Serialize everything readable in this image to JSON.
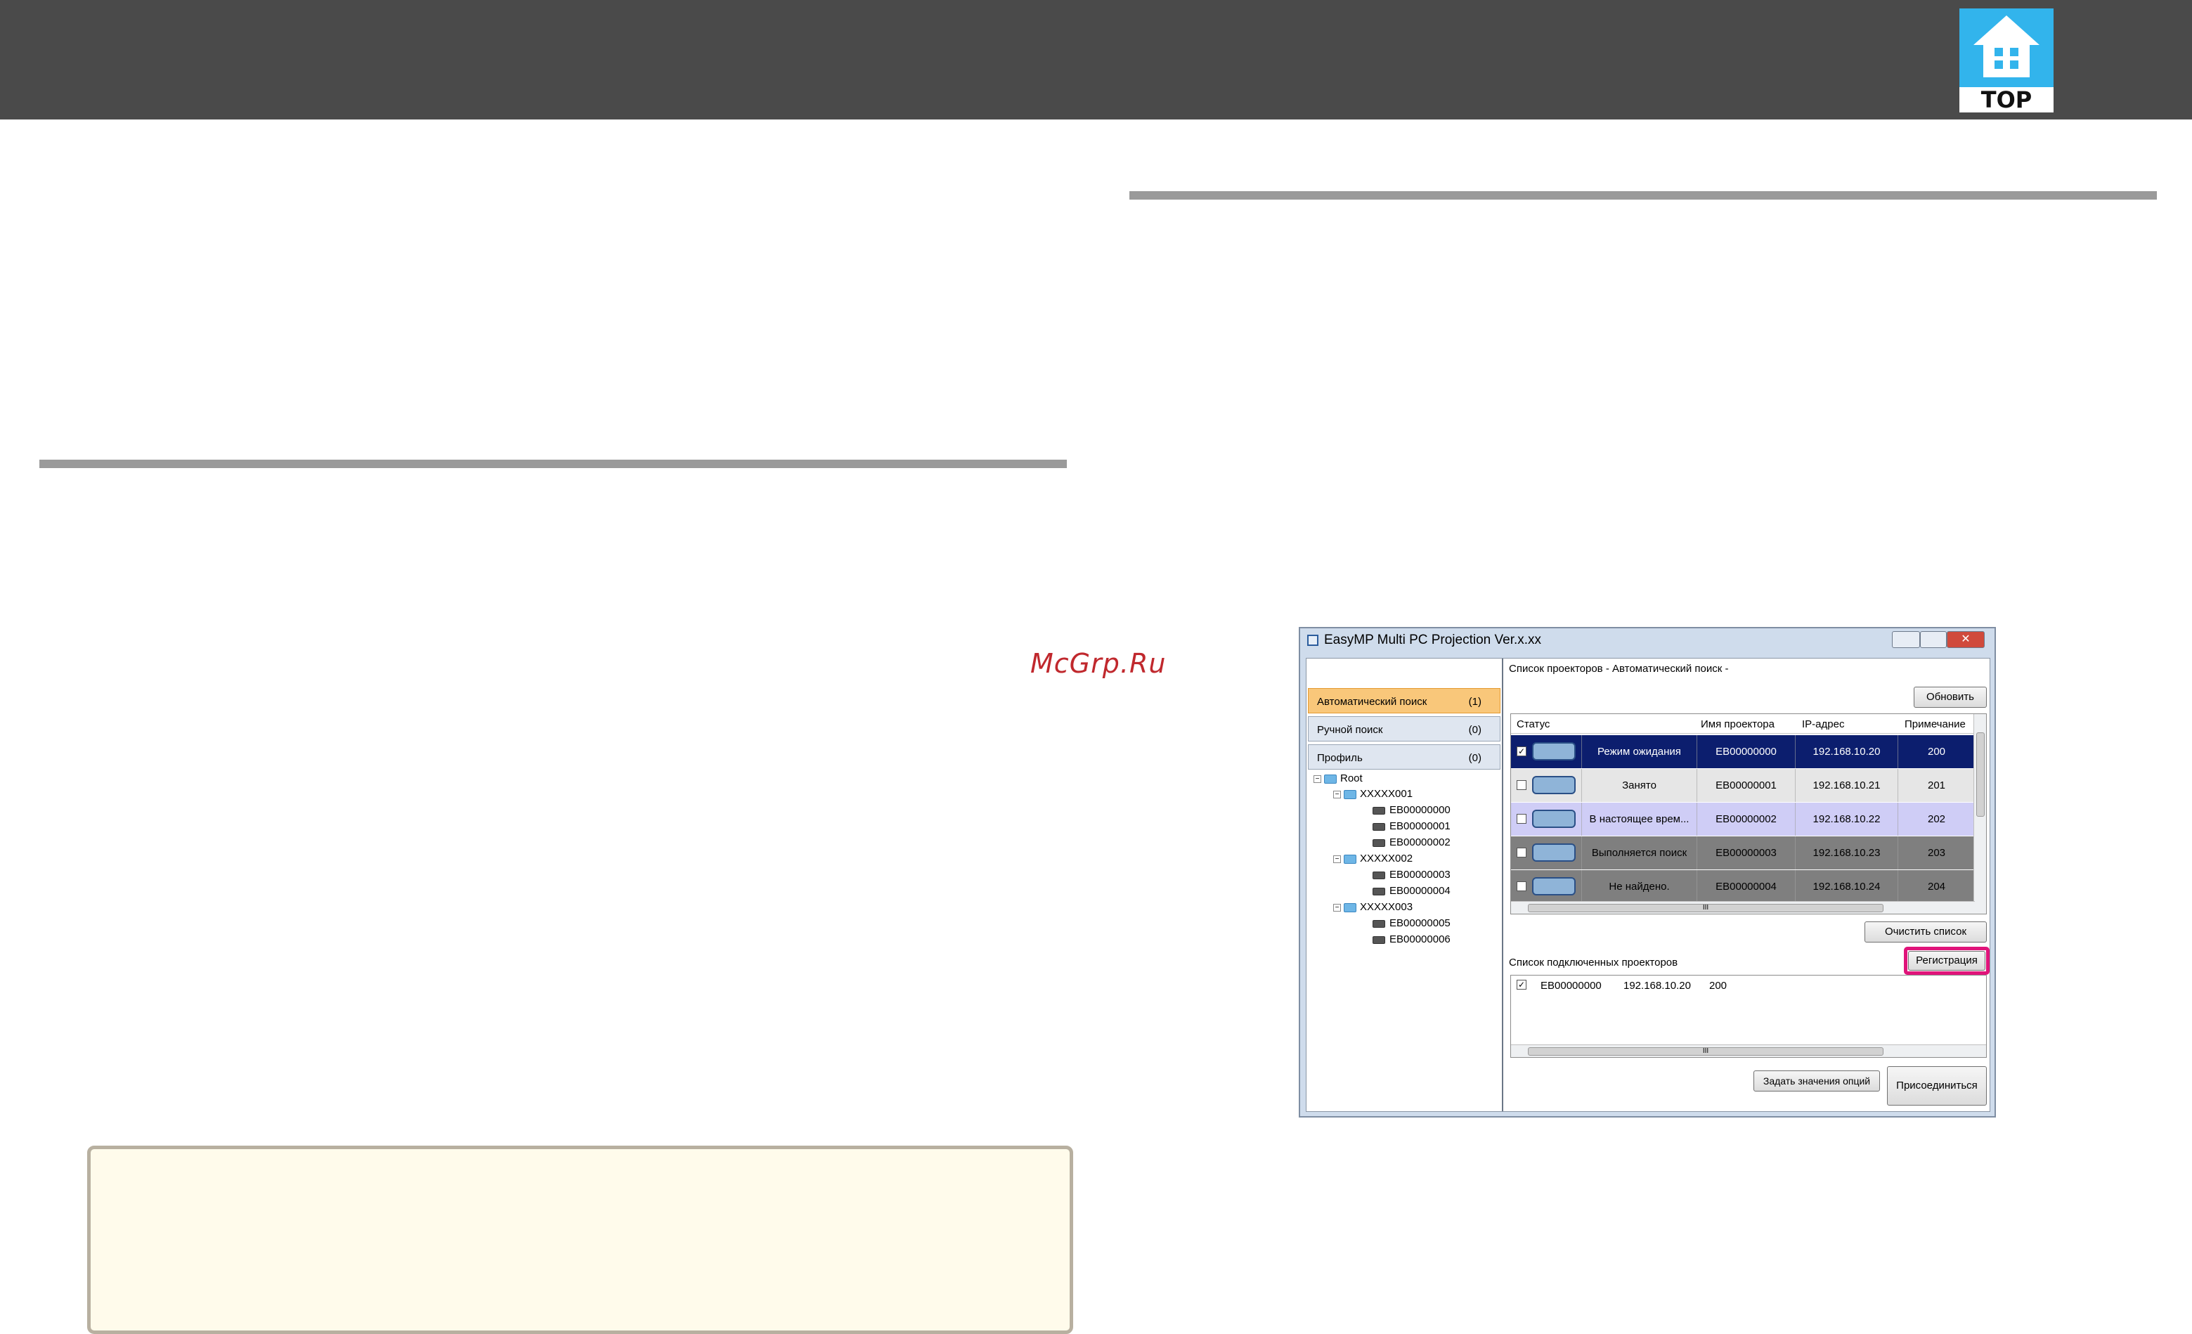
{
  "header": {
    "logo_label": "TOP",
    "logo_color": "#32b4ec",
    "bar_color": "#4a4a4a"
  },
  "watermark": "McGrp.Ru",
  "window": {
    "title": "EasyMP Multi PC Projection Ver.x.xx",
    "close_glyph": "✕",
    "nav": [
      {
        "label": "Автоматический поиск",
        "count": "(1)"
      },
      {
        "label": "Ручной поиск",
        "count": "(0)"
      },
      {
        "label": "Профиль",
        "count": "(0)"
      }
    ],
    "tree": {
      "root": "Root",
      "groups": [
        {
          "name": "XXXXX001",
          "items": [
            "EB00000000",
            "EB00000001",
            "EB00000002"
          ]
        },
        {
          "name": "XXXXX002",
          "items": [
            "EB00000003",
            "EB00000004"
          ]
        },
        {
          "name": "XXXXX003",
          "items": [
            "EB00000005",
            "EB00000006"
          ]
        }
      ]
    },
    "projector_list_label": "Список проекторов - Автоматический поиск -",
    "refresh_button": "Обновить",
    "columns": [
      "Статус",
      "Имя проектора",
      "IP-адрес",
      "Примечание"
    ],
    "rows": [
      {
        "checked": "✓",
        "status": "Режим ожидания",
        "name": "EB00000000",
        "ip": "192.168.10.20",
        "note": "200",
        "bg": "#0c1e6e",
        "fg": "#ffffff"
      },
      {
        "checked": "",
        "status": "Занято",
        "name": "EB00000001",
        "ip": "192.168.10.21",
        "note": "201",
        "bg": "#e6e6e6",
        "fg": "#000000"
      },
      {
        "checked": "",
        "status": "В настоящее врем...",
        "name": "EB00000002",
        "ip": "192.168.10.22",
        "note": "202",
        "bg": "#cfcdf6",
        "fg": "#000000"
      },
      {
        "checked": "",
        "status": "Выполняется поиск",
        "name": "EB00000003",
        "ip": "192.168.10.23",
        "note": "203",
        "bg": "#7f7f7f",
        "fg": "#000000"
      },
      {
        "checked": "",
        "status": "Не найдено.",
        "name": "EB00000004",
        "ip": "192.168.10.24",
        "note": "204",
        "bg": "#7f7f7f",
        "fg": "#000000"
      }
    ],
    "scroll_grip": "III",
    "clear_button": "Очистить список",
    "connected_label": "Список подключенных проекторов",
    "register_button": "Регистрация",
    "connected_row": {
      "checked": "✓",
      "name": "EB00000000",
      "ip": "192.168.10.20",
      "note": "200"
    },
    "options_button": "Задать значения опций",
    "join_button": "Присоединиться"
  },
  "colors": {
    "highlight": "#e0147a",
    "active_nav": "#f9c77a",
    "note_box_bg": "#fffbeb"
  }
}
